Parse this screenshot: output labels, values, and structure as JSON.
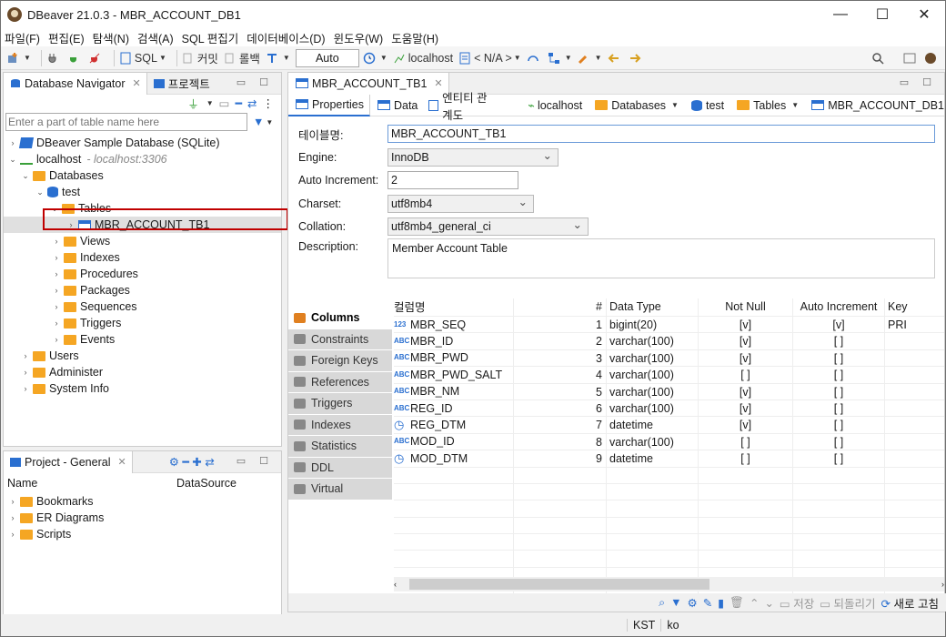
{
  "window": {
    "title": "DBeaver 21.0.3 - MBR_ACCOUNT_DB1",
    "min": "—",
    "max": "☐",
    "close": "✕"
  },
  "menu": [
    "파일(F)",
    "편집(E)",
    "탐색(N)",
    "검색(A)",
    "SQL 편집기",
    "데이터베이스(D)",
    "윈도우(W)",
    "도움말(H)"
  ],
  "toolbar": {
    "sql": "SQL",
    "commit": "커밋",
    "rollback": "롤백",
    "auto": "Auto",
    "host": "localhost",
    "na": "< N/A >"
  },
  "navigator": {
    "tab": "Database Navigator",
    "tab2": "프로젝트",
    "filter_placeholder": "Enter a part of table name here"
  },
  "tree": [
    {
      "label": "DBeaver Sample Database (SQLite)",
      "sub": ""
    },
    {
      "label": "localhost",
      "sub": "- localhost:3306"
    },
    {
      "label": "Databases",
      "sub": ""
    },
    {
      "label": "test",
      "sub": ""
    },
    {
      "label": "Tables",
      "sub": ""
    },
    {
      "label": "MBR_ACCOUNT_TB1",
      "sub": ""
    },
    {
      "label": "Views",
      "sub": ""
    },
    {
      "label": "Indexes",
      "sub": ""
    },
    {
      "label": "Procedures",
      "sub": ""
    },
    {
      "label": "Packages",
      "sub": ""
    },
    {
      "label": "Sequences",
      "sub": ""
    },
    {
      "label": "Triggers",
      "sub": ""
    },
    {
      "label": "Events",
      "sub": ""
    },
    {
      "label": "Users",
      "sub": ""
    },
    {
      "label": "Administer",
      "sub": ""
    },
    {
      "label": "System Info",
      "sub": ""
    }
  ],
  "project": {
    "tab": "Project - General",
    "col_name": "Name",
    "col_ds": "DataSource",
    "items": [
      "Bookmarks",
      "ER Diagrams",
      "Scripts"
    ]
  },
  "editor": {
    "tab": "MBR_ACCOUNT_TB1",
    "sub_tabs": [
      "Properties",
      "Data",
      "엔티티 관계도"
    ],
    "crumbs": [
      "localhost",
      "Databases",
      "test",
      "Tables",
      "MBR_ACCOUNT_DB1"
    ]
  },
  "props": {
    "table_name_label": "테이블명:",
    "table_name": "MBR_ACCOUNT_TB1",
    "engine_label": "Engine:",
    "engine": "InnoDB",
    "ai_label": "Auto Increment:",
    "ai": "2",
    "charset_label": "Charset:",
    "charset": "utf8mb4",
    "collation_label": "Collation:",
    "collation": "utf8mb4_general_ci",
    "desc_label": "Description:",
    "desc": "Member Account Table"
  },
  "sidetabs": [
    "Columns",
    "Constraints",
    "Foreign Keys",
    "References",
    "Triggers",
    "Indexes",
    "Statistics",
    "DDL",
    "Virtual"
  ],
  "grid": {
    "headers": [
      "컬럼명",
      "#",
      "Data Type",
      "Not Null",
      "Auto Increment",
      "Key"
    ],
    "rows": [
      {
        "type": "123",
        "name": "MBR_SEQ",
        "n": "1",
        "dt": "bigint(20)",
        "nn": "[v]",
        "ai": "[v]",
        "key": "PRI"
      },
      {
        "type": "ABC",
        "name": "MBR_ID",
        "n": "2",
        "dt": "varchar(100)",
        "nn": "[v]",
        "ai": "[ ]",
        "key": ""
      },
      {
        "type": "ABC",
        "name": "MBR_PWD",
        "n": "3",
        "dt": "varchar(100)",
        "nn": "[v]",
        "ai": "[ ]",
        "key": ""
      },
      {
        "type": "ABC",
        "name": "MBR_PWD_SALT",
        "n": "4",
        "dt": "varchar(100)",
        "nn": "[ ]",
        "ai": "[ ]",
        "key": ""
      },
      {
        "type": "ABC",
        "name": "MBR_NM",
        "n": "5",
        "dt": "varchar(100)",
        "nn": "[v]",
        "ai": "[ ]",
        "key": ""
      },
      {
        "type": "ABC",
        "name": "REG_ID",
        "n": "6",
        "dt": "varchar(100)",
        "nn": "[v]",
        "ai": "[ ]",
        "key": ""
      },
      {
        "type": "clock",
        "name": "REG_DTM",
        "n": "7",
        "dt": "datetime",
        "nn": "[v]",
        "ai": "[ ]",
        "key": ""
      },
      {
        "type": "ABC",
        "name": "MOD_ID",
        "n": "8",
        "dt": "varchar(100)",
        "nn": "[ ]",
        "ai": "[ ]",
        "key": ""
      },
      {
        "type": "clock",
        "name": "MOD_DTM",
        "n": "9",
        "dt": "datetime",
        "nn": "[ ]",
        "ai": "[ ]",
        "key": ""
      }
    ]
  },
  "bottom": {
    "save": "저장",
    "revert": "되돌리기",
    "refresh": "새로 고침"
  },
  "status": {
    "tz": "KST",
    "lang": "ko"
  }
}
